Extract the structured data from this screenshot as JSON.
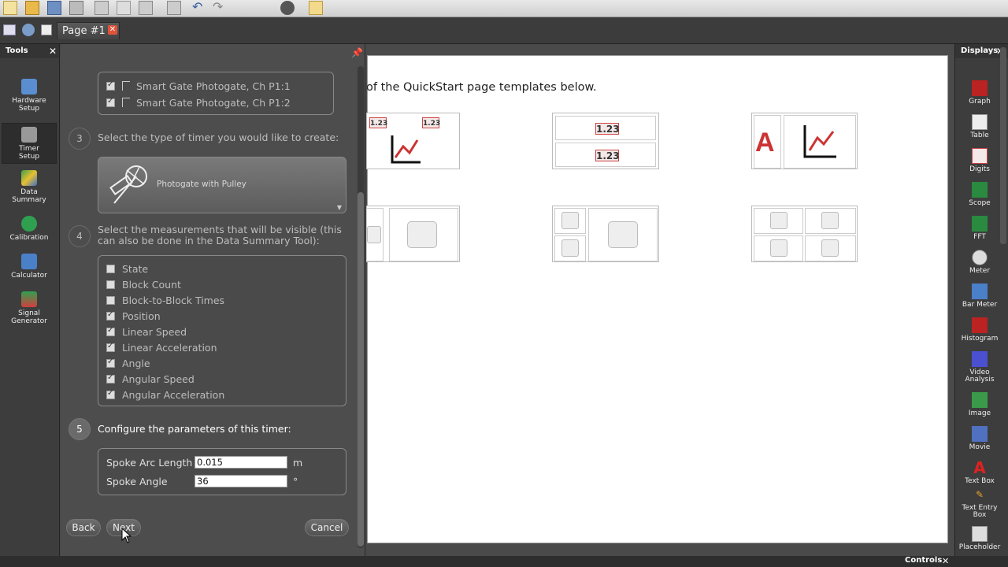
{
  "tab": {
    "label": "Page #1",
    "close_icon": "close-icon"
  },
  "tools_panel": {
    "title": "Tools",
    "items": [
      {
        "label_1": "Hardware",
        "label_2": "Setup",
        "icon": "hardware-icon"
      },
      {
        "label_1": "Timer",
        "label_2": "Setup",
        "icon": "timer-icon"
      },
      {
        "label_1": "Data",
        "label_2": "Summary",
        "icon": "data-summary-icon"
      },
      {
        "label_1": "Calibration",
        "label_2": "",
        "icon": "calibration-icon"
      },
      {
        "label_1": "Calculator",
        "label_2": "",
        "icon": "calculator-icon"
      },
      {
        "label_1": "Signal",
        "label_2": "Generator",
        "icon": "signal-generator-icon"
      }
    ]
  },
  "setup": {
    "sensors": [
      {
        "label": "Smart Gate Photogate, Ch P1:1",
        "checked": true
      },
      {
        "label": "Smart Gate Photogate, Ch P1:2",
        "checked": true
      }
    ],
    "step3": {
      "number": "3",
      "text": "Select the type of timer you would like to create:"
    },
    "timer_type": "Photogate  with Pulley",
    "step4": {
      "number": "4",
      "text": "Select the measurements that will be visible (this can also be done in the Data Summary Tool):"
    },
    "measurements": [
      {
        "label": "State",
        "checked": false
      },
      {
        "label": "Block Count",
        "checked": false
      },
      {
        "label": "Block-to-Block Times",
        "checked": false
      },
      {
        "label": "Position",
        "checked": true
      },
      {
        "label": "Linear Speed",
        "checked": true
      },
      {
        "label": "Linear Acceleration",
        "checked": true
      },
      {
        "label": "Angle",
        "checked": true
      },
      {
        "label": "Angular Speed",
        "checked": true
      },
      {
        "label": "Angular Acceleration",
        "checked": true
      }
    ],
    "step5": {
      "number": "5",
      "text": "Configure the parameters of this timer:"
    },
    "params": [
      {
        "label": "Spoke Arc Length",
        "value": "0.015",
        "unit": "m"
      },
      {
        "label": "Spoke Angle",
        "value": "36",
        "unit": "°"
      }
    ],
    "buttons": {
      "back": "Back",
      "next": "Next",
      "cancel": "Cancel"
    }
  },
  "canvas": {
    "intro": "of the QuickStart page templates below.",
    "digits_label": "1.23",
    "text_glyph": "A"
  },
  "displays_panel": {
    "title": "Displays",
    "items": [
      {
        "label_1": "Graph",
        "label_2": "",
        "icon": "graph-icon"
      },
      {
        "label_1": "Table",
        "label_2": "",
        "icon": "table-icon"
      },
      {
        "label_1": "Digits",
        "label_2": "",
        "icon": "digits-icon"
      },
      {
        "label_1": "Scope",
        "label_2": "",
        "icon": "scope-icon"
      },
      {
        "label_1": "FFT",
        "label_2": "",
        "icon": "fft-icon"
      },
      {
        "label_1": "Meter",
        "label_2": "",
        "icon": "meter-icon"
      },
      {
        "label_1": "Bar Meter",
        "label_2": "",
        "icon": "bar-meter-icon"
      },
      {
        "label_1": "Histogram",
        "label_2": "",
        "icon": "histogram-icon"
      },
      {
        "label_1": "Video",
        "label_2": "Analysis",
        "icon": "video-analysis-icon"
      },
      {
        "label_1": "Image",
        "label_2": "",
        "icon": "image-icon"
      },
      {
        "label_1": "Movie",
        "label_2": "",
        "icon": "movie-icon"
      },
      {
        "label_1": "Text Box",
        "label_2": "",
        "icon": "text-box-icon"
      },
      {
        "label_1": "Text Entry",
        "label_2": "Box",
        "icon": "text-entry-box-icon"
      },
      {
        "label_1": "Placeholder",
        "label_2": "",
        "icon": "placeholder-icon"
      }
    ]
  },
  "status": {
    "controls": "Controls"
  }
}
